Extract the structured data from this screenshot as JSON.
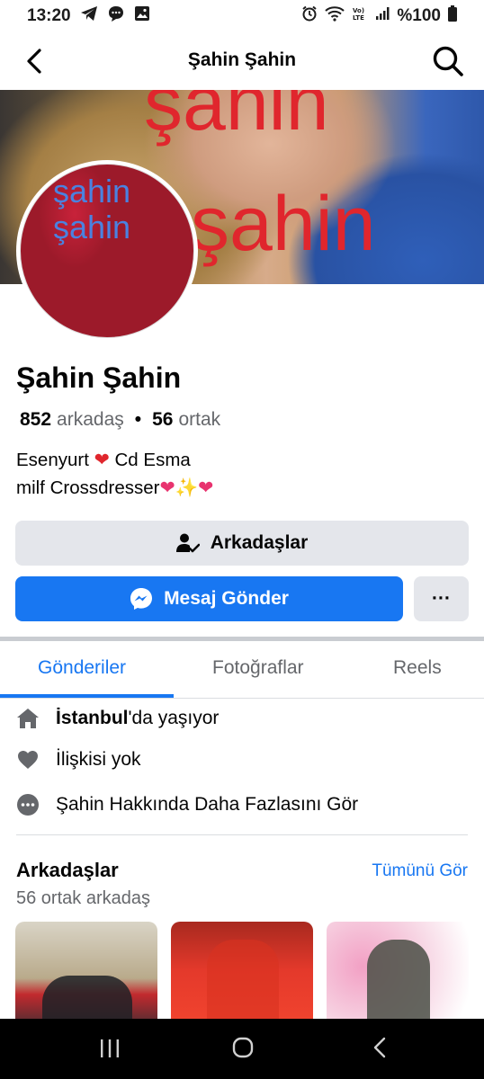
{
  "status_bar": {
    "time": "13:20",
    "battery": "%100",
    "icons": [
      "telegram-icon",
      "message-icon",
      "gallery-icon",
      "alarm-icon",
      "wifi-icon",
      "volte-icon",
      "signal-icon",
      "battery-icon"
    ]
  },
  "header": {
    "title": "Şahin Şahin",
    "back_icon": "chevron-left-icon",
    "search_icon": "search-icon"
  },
  "cover": {
    "overlay_line1": "şahin",
    "overlay_line2": "şahin"
  },
  "avatar": {
    "overlay_line1": "şahin",
    "overlay_line2": "şahin"
  },
  "profile": {
    "name": "Şahin Şahin",
    "friends_count": "852",
    "friends_label": "arkadaş",
    "mutual_count": "56",
    "mutual_label": "ortak",
    "bio_line1_a": "Esenyurt",
    "bio_line1_b": "Cd Esma",
    "bio_line2": "milf Crossdresser"
  },
  "actions": {
    "friends_button": "Arkadaşlar",
    "message_button": "Mesaj Gönder",
    "more_button": "···"
  },
  "tabs": [
    {
      "label": "Gönderiler",
      "active": true
    },
    {
      "label": "Fotoğraflar",
      "active": false
    },
    {
      "label": "Reels",
      "active": false
    }
  ],
  "details": {
    "lives_in_bold": "İstanbul",
    "lives_in_rest": "'da yaşıyor",
    "relationship": "İlişkisi yok",
    "see_more": "Şahin Hakkında Daha Fazlasını Gör"
  },
  "friends_section": {
    "title": "Arkadaşlar",
    "see_all": "Tümünü Gör",
    "mutual_friends": "56 ortak arkadaş"
  },
  "colors": {
    "accent": "#1877f2",
    "secondary_button": "#e4e6eb",
    "muted_text": "#65676b",
    "cover_text": "#e0262d"
  }
}
